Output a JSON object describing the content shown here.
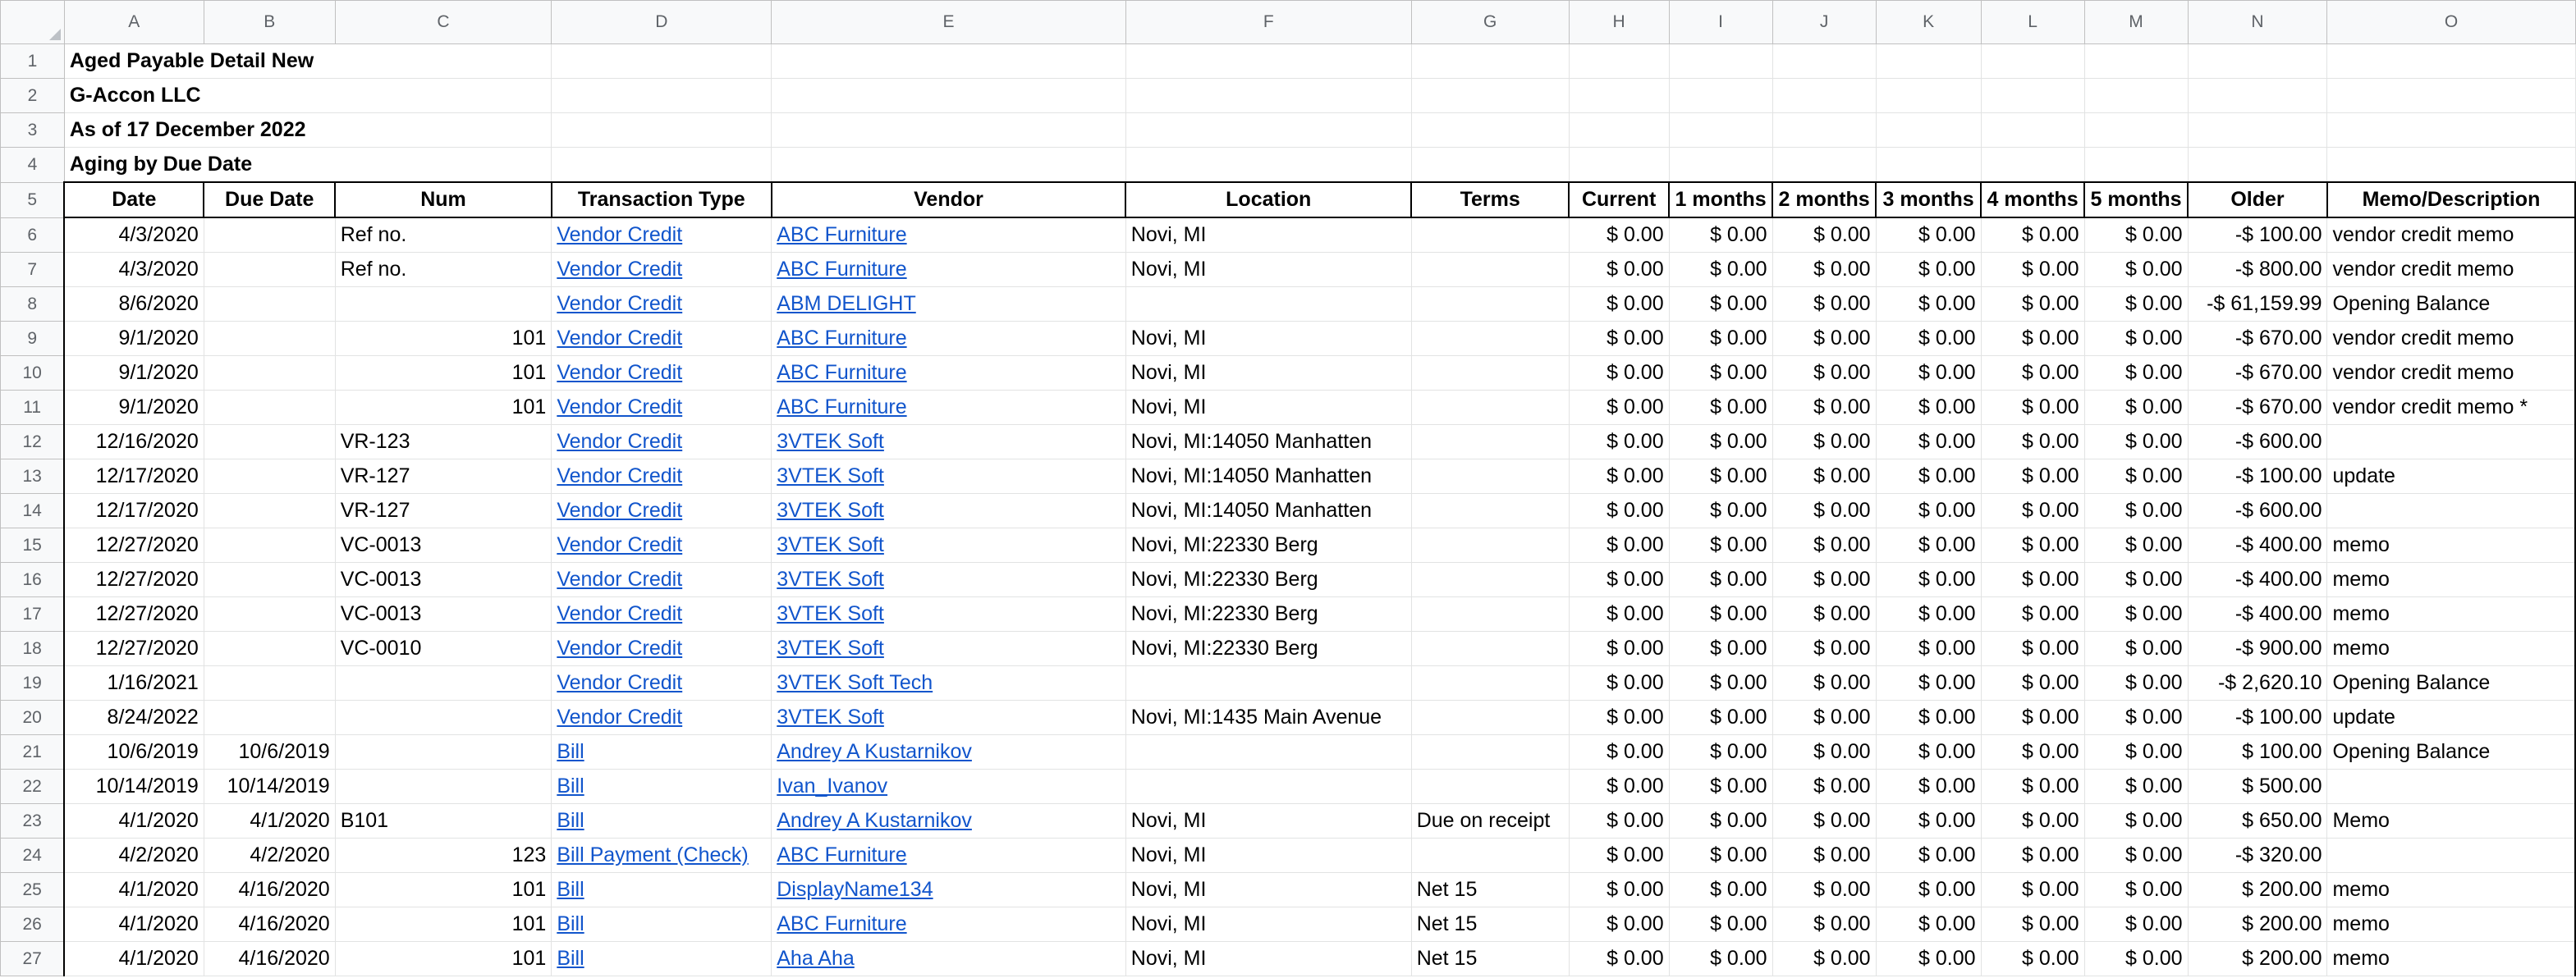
{
  "columns": [
    "A",
    "B",
    "C",
    "D",
    "E",
    "F",
    "G",
    "H",
    "I",
    "J",
    "K",
    "L",
    "M",
    "N",
    "O"
  ],
  "title_rows": [
    {
      "row": "1",
      "text": "Aged Payable Detail New"
    },
    {
      "row": "2",
      "text": "G-Accon LLC"
    },
    {
      "row": "3",
      "text": "As of 17 December 2022"
    },
    {
      "row": "4",
      "text": "Aging by Due Date"
    }
  ],
  "header": {
    "row": "5",
    "cells": [
      "Date",
      "Due Date",
      "Num",
      "Transaction Type",
      "Vendor",
      "Location",
      "Terms",
      "Current",
      "1 months",
      "2 months",
      "3 months",
      "4 months",
      "5 months",
      "Older",
      "Memo/Description"
    ]
  },
  "rows": [
    {
      "row": "6",
      "date": "4/3/2020",
      "due": "",
      "num": "Ref no.",
      "num_align": "l",
      "type": "Vendor Credit",
      "vendor": "ABC Furniture",
      "location": "Novi, MI",
      "terms": "",
      "current": "$ 0.00",
      "m1": "$ 0.00",
      "m2": "$ 0.00",
      "m3": "$ 0.00",
      "m4": "$ 0.00",
      "m5": "$ 0.00",
      "older": "-$ 100.00",
      "memo": "vendor credit memo"
    },
    {
      "row": "7",
      "date": "4/3/2020",
      "due": "",
      "num": "Ref no.",
      "num_align": "l",
      "type": "Vendor Credit",
      "vendor": "ABC Furniture",
      "location": "Novi, MI",
      "terms": "",
      "current": "$ 0.00",
      "m1": "$ 0.00",
      "m2": "$ 0.00",
      "m3": "$ 0.00",
      "m4": "$ 0.00",
      "m5": "$ 0.00",
      "older": "-$ 800.00",
      "memo": "vendor credit memo"
    },
    {
      "row": "8",
      "date": "8/6/2020",
      "due": "",
      "num": "",
      "num_align": "l",
      "type": "Vendor Credit",
      "vendor": "ABM DELIGHT",
      "location": "",
      "terms": "",
      "current": "$ 0.00",
      "m1": "$ 0.00",
      "m2": "$ 0.00",
      "m3": "$ 0.00",
      "m4": "$ 0.00",
      "m5": "$ 0.00",
      "older": "-$ 61,159.99",
      "memo": "Opening Balance"
    },
    {
      "row": "9",
      "date": "9/1/2020",
      "due": "",
      "num": "101",
      "num_align": "r",
      "type": "Vendor Credit",
      "vendor": "ABC Furniture",
      "location": "Novi, MI",
      "terms": "",
      "current": "$ 0.00",
      "m1": "$ 0.00",
      "m2": "$ 0.00",
      "m3": "$ 0.00",
      "m4": "$ 0.00",
      "m5": "$ 0.00",
      "older": "-$ 670.00",
      "memo": "vendor credit memo"
    },
    {
      "row": "10",
      "date": "9/1/2020",
      "due": "",
      "num": "101",
      "num_align": "r",
      "type": "Vendor Credit",
      "vendor": "ABC Furniture",
      "location": "Novi, MI",
      "terms": "",
      "current": "$ 0.00",
      "m1": "$ 0.00",
      "m2": "$ 0.00",
      "m3": "$ 0.00",
      "m4": "$ 0.00",
      "m5": "$ 0.00",
      "older": "-$ 670.00",
      "memo": "vendor credit memo"
    },
    {
      "row": "11",
      "date": "9/1/2020",
      "due": "",
      "num": "101",
      "num_align": "r",
      "type": "Vendor Credit",
      "vendor": "ABC Furniture",
      "location": "Novi, MI",
      "terms": "",
      "current": "$ 0.00",
      "m1": "$ 0.00",
      "m2": "$ 0.00",
      "m3": "$ 0.00",
      "m4": "$ 0.00",
      "m5": "$ 0.00",
      "older": "-$ 670.00",
      "memo": "vendor credit memo *"
    },
    {
      "row": "12",
      "date": "12/16/2020",
      "due": "",
      "num": "VR-123",
      "num_align": "l",
      "type": "Vendor Credit",
      "vendor": "3VTEK Soft",
      "location": "Novi, MI:14050 Manhatten",
      "terms": "",
      "current": "$ 0.00",
      "m1": "$ 0.00",
      "m2": "$ 0.00",
      "m3": "$ 0.00",
      "m4": "$ 0.00",
      "m5": "$ 0.00",
      "older": "-$ 600.00",
      "memo": ""
    },
    {
      "row": "13",
      "date": "12/17/2020",
      "due": "",
      "num": "VR-127",
      "num_align": "l",
      "type": "Vendor Credit",
      "vendor": "3VTEK Soft",
      "location": "Novi, MI:14050 Manhatten",
      "terms": "",
      "current": "$ 0.00",
      "m1": "$ 0.00",
      "m2": "$ 0.00",
      "m3": "$ 0.00",
      "m4": "$ 0.00",
      "m5": "$ 0.00",
      "older": "-$ 100.00",
      "memo": "update"
    },
    {
      "row": "14",
      "date": "12/17/2020",
      "due": "",
      "num": "VR-127",
      "num_align": "l",
      "type": "Vendor Credit",
      "vendor": "3VTEK Soft",
      "location": "Novi, MI:14050 Manhatten",
      "terms": "",
      "current": "$ 0.00",
      "m1": "$ 0.00",
      "m2": "$ 0.00",
      "m3": "$ 0.00",
      "m4": "$ 0.00",
      "m5": "$ 0.00",
      "older": "-$ 600.00",
      "memo": ""
    },
    {
      "row": "15",
      "date": "12/27/2020",
      "due": "",
      "num": "VC-0013",
      "num_align": "l",
      "type": "Vendor Credit",
      "vendor": "3VTEK Soft",
      "location": "Novi, MI:22330 Berg",
      "terms": "",
      "current": "$ 0.00",
      "m1": "$ 0.00",
      "m2": "$ 0.00",
      "m3": "$ 0.00",
      "m4": "$ 0.00",
      "m5": "$ 0.00",
      "older": "-$ 400.00",
      "memo": "memo"
    },
    {
      "row": "16",
      "date": "12/27/2020",
      "due": "",
      "num": "VC-0013",
      "num_align": "l",
      "type": "Vendor Credit",
      "vendor": "3VTEK Soft",
      "location": "Novi, MI:22330 Berg",
      "terms": "",
      "current": "$ 0.00",
      "m1": "$ 0.00",
      "m2": "$ 0.00",
      "m3": "$ 0.00",
      "m4": "$ 0.00",
      "m5": "$ 0.00",
      "older": "-$ 400.00",
      "memo": "memo"
    },
    {
      "row": "17",
      "date": "12/27/2020",
      "due": "",
      "num": "VC-0013",
      "num_align": "l",
      "type": "Vendor Credit",
      "vendor": "3VTEK Soft",
      "location": "Novi, MI:22330 Berg",
      "terms": "",
      "current": "$ 0.00",
      "m1": "$ 0.00",
      "m2": "$ 0.00",
      "m3": "$ 0.00",
      "m4": "$ 0.00",
      "m5": "$ 0.00",
      "older": "-$ 400.00",
      "memo": "memo"
    },
    {
      "row": "18",
      "date": "12/27/2020",
      "due": "",
      "num": "VC-0010",
      "num_align": "l",
      "type": "Vendor Credit",
      "vendor": "3VTEK Soft",
      "location": "Novi, MI:22330 Berg",
      "terms": "",
      "current": "$ 0.00",
      "m1": "$ 0.00",
      "m2": "$ 0.00",
      "m3": "$ 0.00",
      "m4": "$ 0.00",
      "m5": "$ 0.00",
      "older": "-$ 900.00",
      "memo": "memo"
    },
    {
      "row": "19",
      "date": "1/16/2021",
      "due": "",
      "num": "",
      "num_align": "l",
      "type": "Vendor Credit",
      "vendor": "3VTEK Soft Tech",
      "location": "",
      "terms": "",
      "current": "$ 0.00",
      "m1": "$ 0.00",
      "m2": "$ 0.00",
      "m3": "$ 0.00",
      "m4": "$ 0.00",
      "m5": "$ 0.00",
      "older": "-$ 2,620.10",
      "memo": "Opening Balance"
    },
    {
      "row": "20",
      "date": "8/24/2022",
      "due": "",
      "num": "",
      "num_align": "l",
      "type": "Vendor Credit",
      "vendor": "3VTEK Soft",
      "location": "Novi, MI:1435 Main Avenue",
      "terms": "",
      "current": "$ 0.00",
      "m1": "$ 0.00",
      "m2": "$ 0.00",
      "m3": "$ 0.00",
      "m4": "$ 0.00",
      "m5": "$ 0.00",
      "older": "-$ 100.00",
      "memo": "update"
    },
    {
      "row": "21",
      "date": "10/6/2019",
      "due": "10/6/2019",
      "num": "",
      "num_align": "l",
      "type": "Bill",
      "vendor": "Andrey A Kustarnikov",
      "location": "",
      "terms": "",
      "current": "$ 0.00",
      "m1": "$ 0.00",
      "m2": "$ 0.00",
      "m3": "$ 0.00",
      "m4": "$ 0.00",
      "m5": "$ 0.00",
      "older": "$ 100.00",
      "memo": "Opening Balance"
    },
    {
      "row": "22",
      "date": "10/14/2019",
      "due": "10/14/2019",
      "num": "",
      "num_align": "l",
      "type": "Bill",
      "vendor": "Ivan_Ivanov",
      "location": "",
      "terms": "",
      "current": "$ 0.00",
      "m1": "$ 0.00",
      "m2": "$ 0.00",
      "m3": "$ 0.00",
      "m4": "$ 0.00",
      "m5": "$ 0.00",
      "older": "$ 500.00",
      "memo": ""
    },
    {
      "row": "23",
      "date": "4/1/2020",
      "due": "4/1/2020",
      "num": "B101",
      "num_align": "l",
      "type": "Bill",
      "vendor": "Andrey A Kustarnikov",
      "location": "Novi, MI",
      "terms": "Due on receipt",
      "current": "$ 0.00",
      "m1": "$ 0.00",
      "m2": "$ 0.00",
      "m3": "$ 0.00",
      "m4": "$ 0.00",
      "m5": "$ 0.00",
      "older": "$ 650.00",
      "memo": "Memo"
    },
    {
      "row": "24",
      "date": "4/2/2020",
      "due": "4/2/2020",
      "num": "123",
      "num_align": "r",
      "type": "Bill Payment (Check)",
      "vendor": "ABC Furniture",
      "location": "Novi, MI",
      "terms": "",
      "current": "$ 0.00",
      "m1": "$ 0.00",
      "m2": "$ 0.00",
      "m3": "$ 0.00",
      "m4": "$ 0.00",
      "m5": "$ 0.00",
      "older": "-$ 320.00",
      "memo": ""
    },
    {
      "row": "25",
      "date": "4/1/2020",
      "due": "4/16/2020",
      "num": "101",
      "num_align": "r",
      "type": "Bill",
      "vendor": "DisplayName134",
      "location": "Novi, MI",
      "terms": "Net 15",
      "current": "$ 0.00",
      "m1": "$ 0.00",
      "m2": "$ 0.00",
      "m3": "$ 0.00",
      "m4": "$ 0.00",
      "m5": "$ 0.00",
      "older": "$ 200.00",
      "memo": "memo"
    },
    {
      "row": "26",
      "date": "4/1/2020",
      "due": "4/16/2020",
      "num": "101",
      "num_align": "r",
      "type": "Bill",
      "vendor": "ABC Furniture",
      "location": "Novi, MI",
      "terms": "Net 15",
      "current": "$ 0.00",
      "m1": "$ 0.00",
      "m2": "$ 0.00",
      "m3": "$ 0.00",
      "m4": "$ 0.00",
      "m5": "$ 0.00",
      "older": "$ 200.00",
      "memo": "memo"
    },
    {
      "row": "27",
      "date": "4/1/2020",
      "due": "4/16/2020",
      "num": "101",
      "num_align": "r",
      "type": "Bill",
      "vendor": "Aha Aha",
      "location": "Novi, MI",
      "terms": "Net 15",
      "current": "$ 0.00",
      "m1": "$ 0.00",
      "m2": "$ 0.00",
      "m3": "$ 0.00",
      "m4": "$ 0.00",
      "m5": "$ 0.00",
      "older": "$ 200.00",
      "memo": "memo"
    }
  ]
}
